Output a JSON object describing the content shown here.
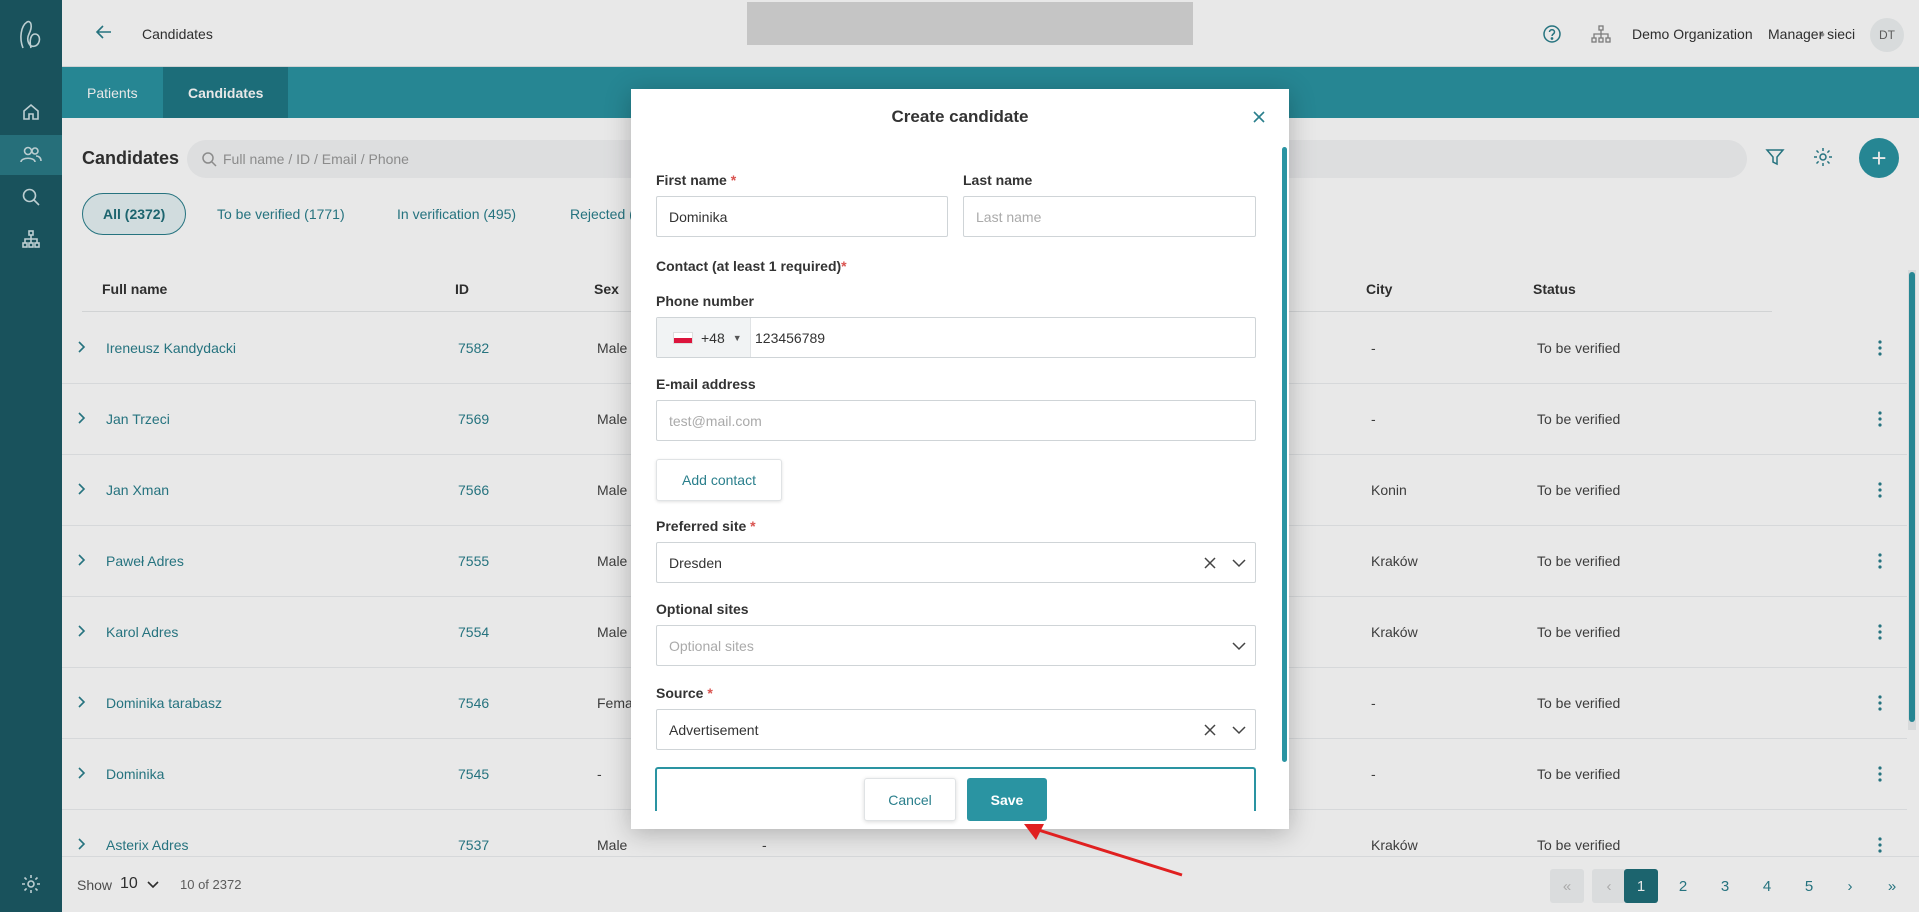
{
  "header": {
    "breadcrumb": "Candidates",
    "organization": "Demo Organization",
    "separator": "•",
    "role": "Manager sieci",
    "avatar_initials": "DT"
  },
  "tabs": [
    {
      "label": "Patients",
      "active": false
    },
    {
      "label": "Candidates",
      "active": true
    }
  ],
  "list": {
    "title": "Candidates",
    "search_placeholder": "Full name / ID / Email / Phone",
    "filters": [
      {
        "label": "All (2372)",
        "active": true
      },
      {
        "label": "To be verified (1771)",
        "active": false
      },
      {
        "label": "In verification (495)",
        "active": false
      },
      {
        "label": "Rejected (",
        "active": false
      }
    ],
    "columns": {
      "full_name": "Full name",
      "id": "ID",
      "sex": "Sex",
      "city": "City",
      "status": "Status"
    },
    "rows": [
      {
        "name": "Ireneusz Kandydacki",
        "id": "7582",
        "sex": "Male",
        "mid": "",
        "city": "-",
        "status": "To be verified"
      },
      {
        "name": "Jan Trzeci",
        "id": "7569",
        "sex": "Male",
        "mid": "",
        "city": "-",
        "status": "To be verified"
      },
      {
        "name": "Jan Xman",
        "id": "7566",
        "sex": "Male",
        "mid": "",
        "city": "Konin",
        "status": "To be verified"
      },
      {
        "name": "Paweł Adres",
        "id": "7555",
        "sex": "Male",
        "mid": "",
        "city": "Kraków",
        "status": "To be verified"
      },
      {
        "name": "Karol Adres",
        "id": "7554",
        "sex": "Male",
        "mid": "",
        "city": "Kraków",
        "status": "To be verified"
      },
      {
        "name": "Dominika tarabasz",
        "id": "7546",
        "sex": "Fema",
        "mid": "",
        "city": "-",
        "status": "To be verified"
      },
      {
        "name": "Dominika",
        "id": "7545",
        "sex": "-",
        "mid": "",
        "city": "-",
        "status": "To be verified"
      },
      {
        "name": "Asterix Adres",
        "id": "7537",
        "sex": "Male",
        "mid": "-",
        "city": "Kraków",
        "status": "To be verified"
      }
    ]
  },
  "pagination": {
    "show_label": "Show",
    "page_size": "10",
    "count": "10 of 2372",
    "first": "«",
    "prev": "‹",
    "pages": [
      "1",
      "2",
      "3",
      "4",
      "5"
    ],
    "next": "›",
    "last": "»",
    "current": "1"
  },
  "modal": {
    "title": "Create candidate",
    "first_name_label": "First name",
    "first_name_value": "Dominika",
    "last_name_label": "Last name",
    "last_name_placeholder": "Last name",
    "contact_label": "Contact (at least 1 required)",
    "phone_label": "Phone number",
    "phone_prefix": "+48",
    "phone_value": "123456789",
    "email_label": "E-mail address",
    "email_placeholder": "test@mail.com",
    "add_contact": "Add contact",
    "preferred_site_label": "Preferred site",
    "preferred_site_value": "Dresden",
    "optional_sites_label": "Optional sites",
    "optional_sites_placeholder": "Optional sites",
    "source_label": "Source",
    "source_value": "Advertisement",
    "required_mark": "*",
    "cancel": "Cancel",
    "save": "Save"
  },
  "colors": {
    "sidebar": "#1c5b66",
    "accent": "#2a94a2",
    "arrow": "#e02020"
  }
}
